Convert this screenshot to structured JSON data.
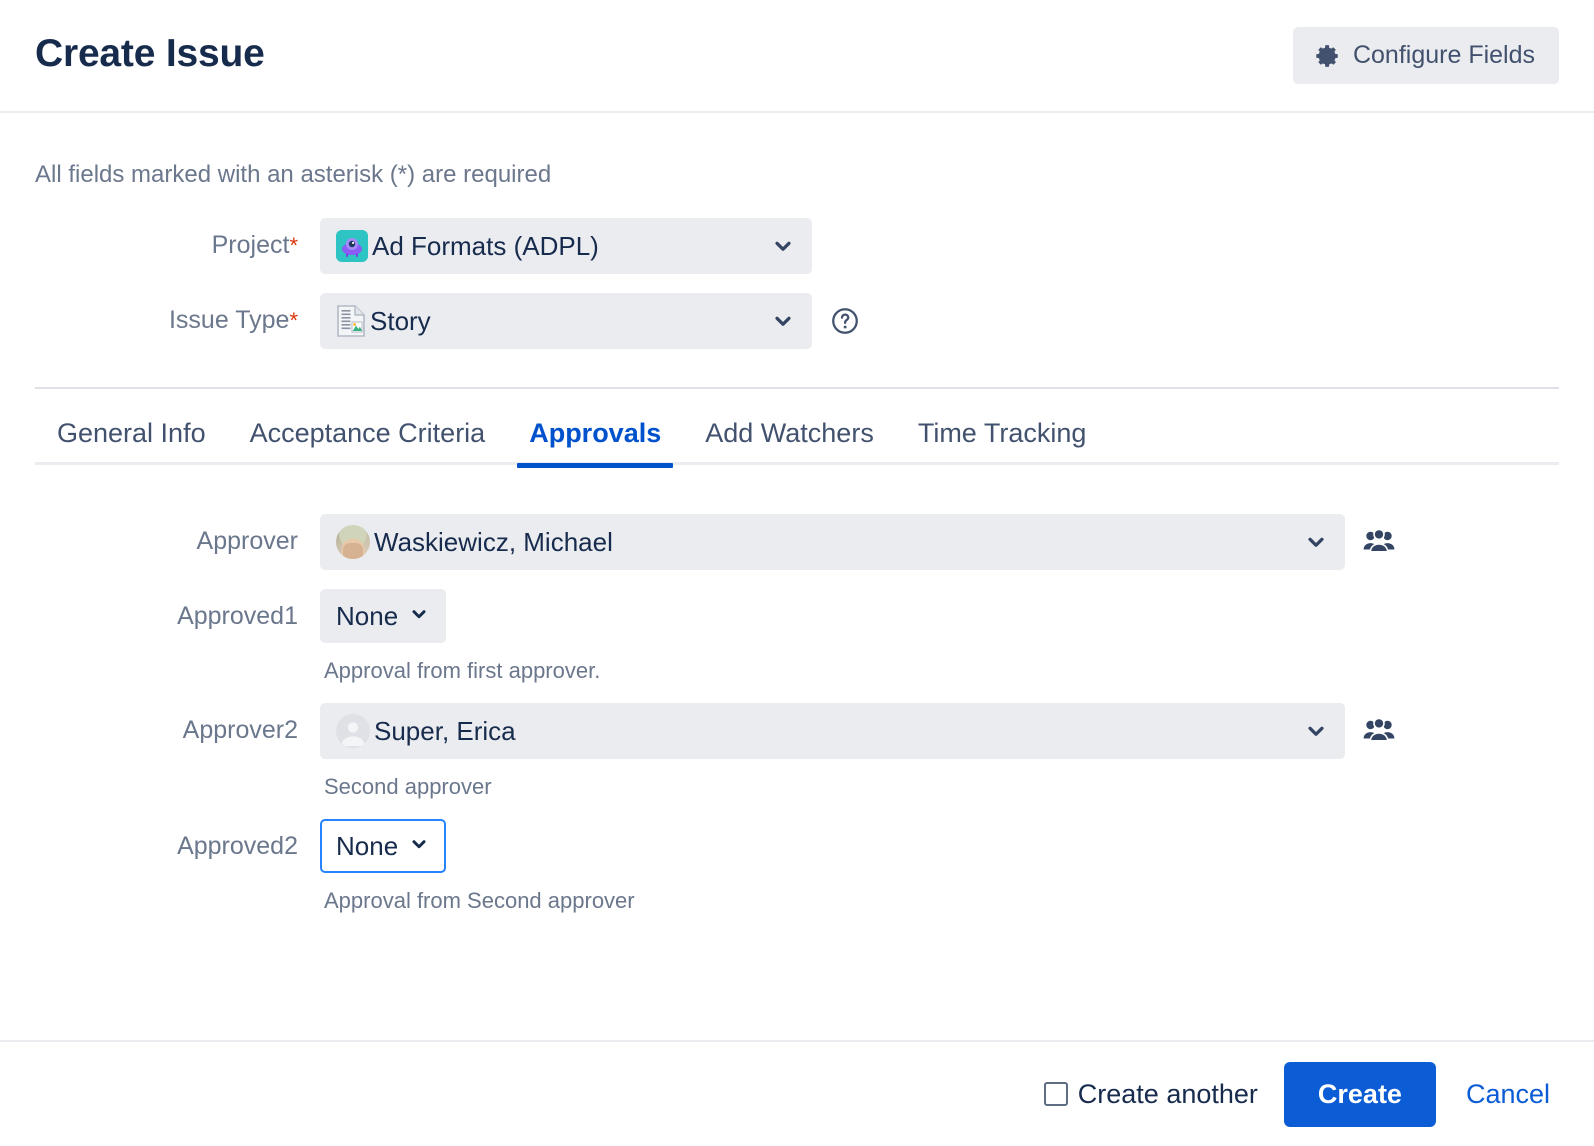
{
  "header": {
    "title": "Create Issue",
    "configure_fields_label": "Configure Fields",
    "gear_icon": "gear-icon"
  },
  "body": {
    "required_note": "All fields marked with an asterisk (*) are required",
    "required_marker": "*"
  },
  "fields": {
    "project": {
      "label": "Project",
      "required": true,
      "value": "Ad Formats (ADPL)",
      "icon": "project-avatar-icon",
      "chevron_icon": "chevron-down-icon"
    },
    "issue_type": {
      "label": "Issue Type",
      "required": true,
      "value": "Story",
      "icon": "story-type-icon",
      "chevron_icon": "chevron-down-icon",
      "help_icon": "question-circle-icon"
    },
    "approver": {
      "label": "Approver",
      "value": "Waskiewicz, Michael",
      "avatar": "user-avatar-photo",
      "chevron_icon": "chevron-down-icon",
      "picker_icon": "people-group-icon"
    },
    "approved1": {
      "label": "Approved1",
      "value": "None",
      "description": "Approval from first approver.",
      "chevron_icon": "chevron-down-icon"
    },
    "approver2": {
      "label": "Approver2",
      "value": "Super, Erica",
      "description": "Second approver",
      "avatar": "user-avatar-generic",
      "chevron_icon": "chevron-down-icon",
      "picker_icon": "people-group-icon"
    },
    "approved2": {
      "label": "Approved2",
      "value": "None",
      "description": "Approval from Second approver",
      "chevron_icon": "chevron-down-icon",
      "focused": true
    }
  },
  "tabs": [
    {
      "label": "General Info",
      "active": false
    },
    {
      "label": "Acceptance Criteria",
      "active": false
    },
    {
      "label": "Approvals",
      "active": true
    },
    {
      "label": "Add Watchers",
      "active": false
    },
    {
      "label": "Time Tracking",
      "active": false
    }
  ],
  "footer": {
    "create_another_label": "Create another",
    "create_another_checked": false,
    "create_label": "Create",
    "cancel_label": "Cancel"
  },
  "colors": {
    "accent_blue": "#0052cc",
    "button_blue": "#0b5cd5",
    "focus_blue": "#2684ff",
    "required_red": "#de350b",
    "field_bg": "#ebecf0",
    "label_gray": "#6b778c",
    "text_dark": "#172b4d"
  }
}
